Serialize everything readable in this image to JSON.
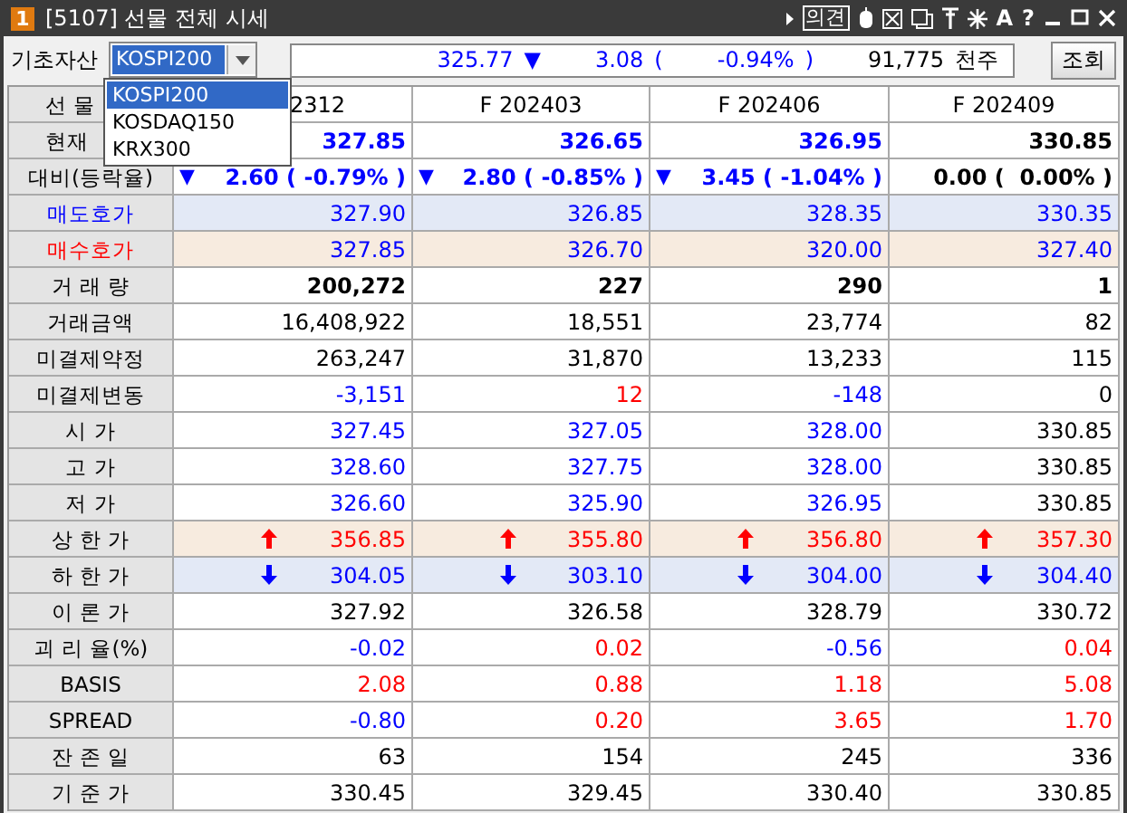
{
  "window": {
    "badge": "1",
    "title": "[5107] 선물 전체 시세",
    "opinion_button": "의견",
    "help_label": "?",
    "font_label": "A"
  },
  "toolbar": {
    "asset_label": "기초자산",
    "asset_value": "KOSPI200",
    "dropdown_open": true,
    "options": [
      {
        "label": "KOSPI200",
        "selected": true
      },
      {
        "label": "KOSDAQ150",
        "selected": false
      },
      {
        "label": "KRX300",
        "selected": false
      }
    ],
    "summary": {
      "price": "325.77",
      "arrow": "▼",
      "change": "3.08",
      "rate_open": "(",
      "rate": "-0.94%",
      "rate_close": ")",
      "volume": "91,775",
      "unit": "천주"
    },
    "query_button": "조회"
  },
  "table": {
    "corner": "선 물",
    "columns": [
      {
        "label": "2312"
      },
      {
        "label": "F 202403"
      },
      {
        "label": "F 202406"
      },
      {
        "label": "F 202409"
      }
    ],
    "rows": [
      {
        "label": "현재",
        "kind": "price",
        "cells": [
          {
            "text": "327.85",
            "color": "#0000ff"
          },
          {
            "text": "326.65",
            "color": "#0000ff"
          },
          {
            "text": "326.95",
            "color": "#0000ff"
          },
          {
            "text": "330.85",
            "color": "#000000"
          }
        ]
      },
      {
        "label": "대비(등락율)",
        "kind": "change",
        "cells": [
          {
            "text": "2.60 ( -0.79% )",
            "color": "#0000ff",
            "arrow": "▼"
          },
          {
            "text": "2.80 ( -0.85% )",
            "color": "#0000ff",
            "arrow": "▼"
          },
          {
            "text": "3.45 ( -1.04% )",
            "color": "#0000ff",
            "arrow": "▼"
          },
          {
            "text": "0.00 (  0.00% )",
            "color": "#000000"
          }
        ]
      },
      {
        "label": "매도호가",
        "kind": "ask",
        "cells": [
          {
            "text": "327.90",
            "color": "#0000ff"
          },
          {
            "text": "326.85",
            "color": "#0000ff"
          },
          {
            "text": "328.35",
            "color": "#0000ff"
          },
          {
            "text": "330.35",
            "color": "#0000ff"
          }
        ]
      },
      {
        "label": "매수호가",
        "kind": "bid",
        "cells": [
          {
            "text": "327.85",
            "color": "#0000ff"
          },
          {
            "text": "326.70",
            "color": "#0000ff"
          },
          {
            "text": "320.00",
            "color": "#0000ff"
          },
          {
            "text": "327.40",
            "color": "#0000ff"
          }
        ]
      },
      {
        "label": "거 래 량",
        "kind": "bold",
        "cells": [
          {
            "text": "200,272",
            "color": "#000000"
          },
          {
            "text": "227",
            "color": "#000000"
          },
          {
            "text": "290",
            "color": "#000000"
          },
          {
            "text": "1",
            "color": "#000000"
          }
        ]
      },
      {
        "label": "거래금액",
        "kind": "plain",
        "cells": [
          {
            "text": "16,408,922",
            "color": "#000000"
          },
          {
            "text": "18,551",
            "color": "#000000"
          },
          {
            "text": "23,774",
            "color": "#000000"
          },
          {
            "text": "82",
            "color": "#000000"
          }
        ]
      },
      {
        "label": "미결제약정",
        "kind": "plain",
        "cells": [
          {
            "text": "263,247",
            "color": "#000000"
          },
          {
            "text": "31,870",
            "color": "#000000"
          },
          {
            "text": "13,233",
            "color": "#000000"
          },
          {
            "text": "115",
            "color": "#000000"
          }
        ]
      },
      {
        "label": "미결제변동",
        "kind": "plain",
        "cells": [
          {
            "text": "-3,151",
            "color": "#0000ff"
          },
          {
            "text": "12",
            "color": "#ff0000"
          },
          {
            "text": "-148",
            "color": "#0000ff"
          },
          {
            "text": "0",
            "color": "#000000"
          }
        ]
      },
      {
        "label": "시       가",
        "kind": "plain",
        "cells": [
          {
            "text": "327.45",
            "color": "#0000ff"
          },
          {
            "text": "327.05",
            "color": "#0000ff"
          },
          {
            "text": "328.00",
            "color": "#0000ff"
          },
          {
            "text": "330.85",
            "color": "#000000"
          }
        ]
      },
      {
        "label": "고       가",
        "kind": "plain",
        "cells": [
          {
            "text": "328.60",
            "color": "#0000ff"
          },
          {
            "text": "327.75",
            "color": "#0000ff"
          },
          {
            "text": "328.00",
            "color": "#0000ff"
          },
          {
            "text": "330.85",
            "color": "#000000"
          }
        ]
      },
      {
        "label": "저       가",
        "kind": "plain",
        "cells": [
          {
            "text": "326.60",
            "color": "#0000ff"
          },
          {
            "text": "325.90",
            "color": "#0000ff"
          },
          {
            "text": "326.95",
            "color": "#0000ff"
          },
          {
            "text": "330.85",
            "color": "#000000"
          }
        ]
      },
      {
        "label": "상 한 가",
        "kind": "upper",
        "cells": [
          {
            "text": "356.85",
            "color": "#ff0000",
            "kind": "up"
          },
          {
            "text": "355.80",
            "color": "#ff0000",
            "kind": "up"
          },
          {
            "text": "356.80",
            "color": "#ff0000",
            "kind": "up"
          },
          {
            "text": "357.30",
            "color": "#ff0000",
            "kind": "up"
          }
        ]
      },
      {
        "label": "하 한 가",
        "kind": "lower",
        "cells": [
          {
            "text": "304.05",
            "color": "#0000ff",
            "kind": "down"
          },
          {
            "text": "303.10",
            "color": "#0000ff",
            "kind": "down"
          },
          {
            "text": "304.00",
            "color": "#0000ff",
            "kind": "down"
          },
          {
            "text": "304.40",
            "color": "#0000ff",
            "kind": "down"
          }
        ]
      },
      {
        "label": "이 론 가",
        "kind": "plain",
        "cells": [
          {
            "text": "327.92",
            "color": "#000000"
          },
          {
            "text": "326.58",
            "color": "#000000"
          },
          {
            "text": "328.79",
            "color": "#000000"
          },
          {
            "text": "330.72",
            "color": "#000000"
          }
        ]
      },
      {
        "label": "괴 리 율(%)",
        "kind": "plain",
        "cells": [
          {
            "text": "-0.02",
            "color": "#0000ff"
          },
          {
            "text": "0.02",
            "color": "#ff0000"
          },
          {
            "text": "-0.56",
            "color": "#0000ff"
          },
          {
            "text": "0.04",
            "color": "#ff0000"
          }
        ]
      },
      {
        "label": "BASIS",
        "kind": "plain",
        "cells": [
          {
            "text": "2.08",
            "color": "#ff0000"
          },
          {
            "text": "0.88",
            "color": "#ff0000"
          },
          {
            "text": "1.18",
            "color": "#ff0000"
          },
          {
            "text": "5.08",
            "color": "#ff0000"
          }
        ]
      },
      {
        "label": "SPREAD",
        "kind": "plain",
        "cells": [
          {
            "text": "-0.80",
            "color": "#0000ff"
          },
          {
            "text": "0.20",
            "color": "#ff0000"
          },
          {
            "text": "3.65",
            "color": "#ff0000"
          },
          {
            "text": "1.70",
            "color": "#ff0000"
          }
        ]
      },
      {
        "label": "잔 존 일",
        "kind": "plain",
        "cells": [
          {
            "text": "63",
            "color": "#000000"
          },
          {
            "text": "154",
            "color": "#000000"
          },
          {
            "text": "245",
            "color": "#000000"
          },
          {
            "text": "336",
            "color": "#000000"
          }
        ]
      },
      {
        "label": "기 준 가",
        "kind": "plain",
        "cells": [
          {
            "text": "330.45",
            "color": "#000000"
          },
          {
            "text": "329.45",
            "color": "#000000"
          },
          {
            "text": "330.40",
            "color": "#000000"
          },
          {
            "text": "330.85",
            "color": "#000000"
          }
        ]
      }
    ]
  }
}
